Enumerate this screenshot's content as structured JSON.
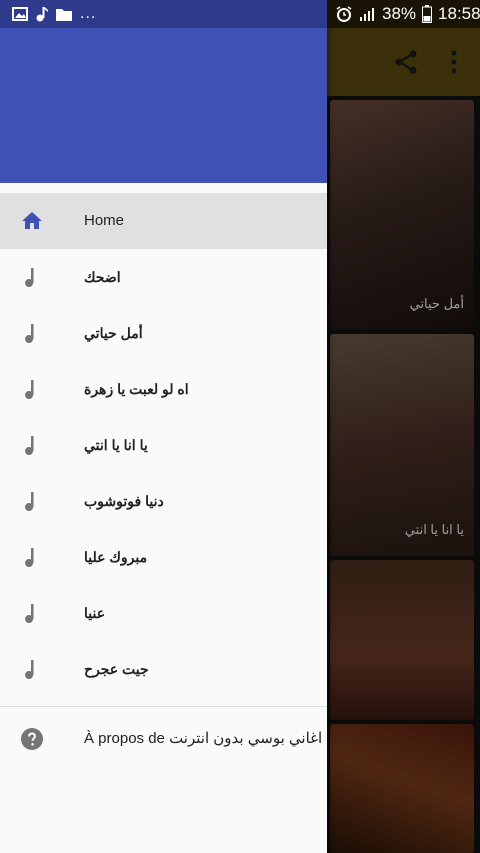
{
  "status_bar": {
    "left_icons": [
      "image-icon",
      "music-note-icon",
      "folder-icon"
    ],
    "ellipsis": "...",
    "battery": "38%",
    "time": "18:58"
  },
  "toolbar": {
    "share_icon": "share-icon",
    "overflow_icon": "overflow-menu-icon"
  },
  "background_cards": [
    {
      "title": "أمل حياتي"
    },
    {
      "title": "يا انا يا انتي"
    },
    {
      "title": ""
    },
    {
      "title": ""
    }
  ],
  "drawer": {
    "items": [
      {
        "label": "Home",
        "icon": "home-icon",
        "active": true
      },
      {
        "label": "اضحك",
        "icon": "music-note-icon"
      },
      {
        "label": "أمل حياتي",
        "icon": "music-note-icon"
      },
      {
        "label": "اه لو لعبت يا زهرة",
        "icon": "music-note-icon"
      },
      {
        "label": "يا انا يا انتي",
        "icon": "music-note-icon"
      },
      {
        "label": "دنيا فوتوشوب",
        "icon": "music-note-icon"
      },
      {
        "label": "مبروك عليا",
        "icon": "music-note-icon"
      },
      {
        "label": "عنيا",
        "icon": "music-note-icon"
      },
      {
        "label": "جيت عجرح",
        "icon": "music-note-icon"
      }
    ],
    "about": {
      "label": "À propos de اغاني بوسي بدون انترنت",
      "icon": "help-icon"
    }
  },
  "colors": {
    "drawer_header": "#3f51b5",
    "active_icon": "#3f51b5",
    "icon_gray": "#757575",
    "toolbar": "#5b4a10"
  }
}
